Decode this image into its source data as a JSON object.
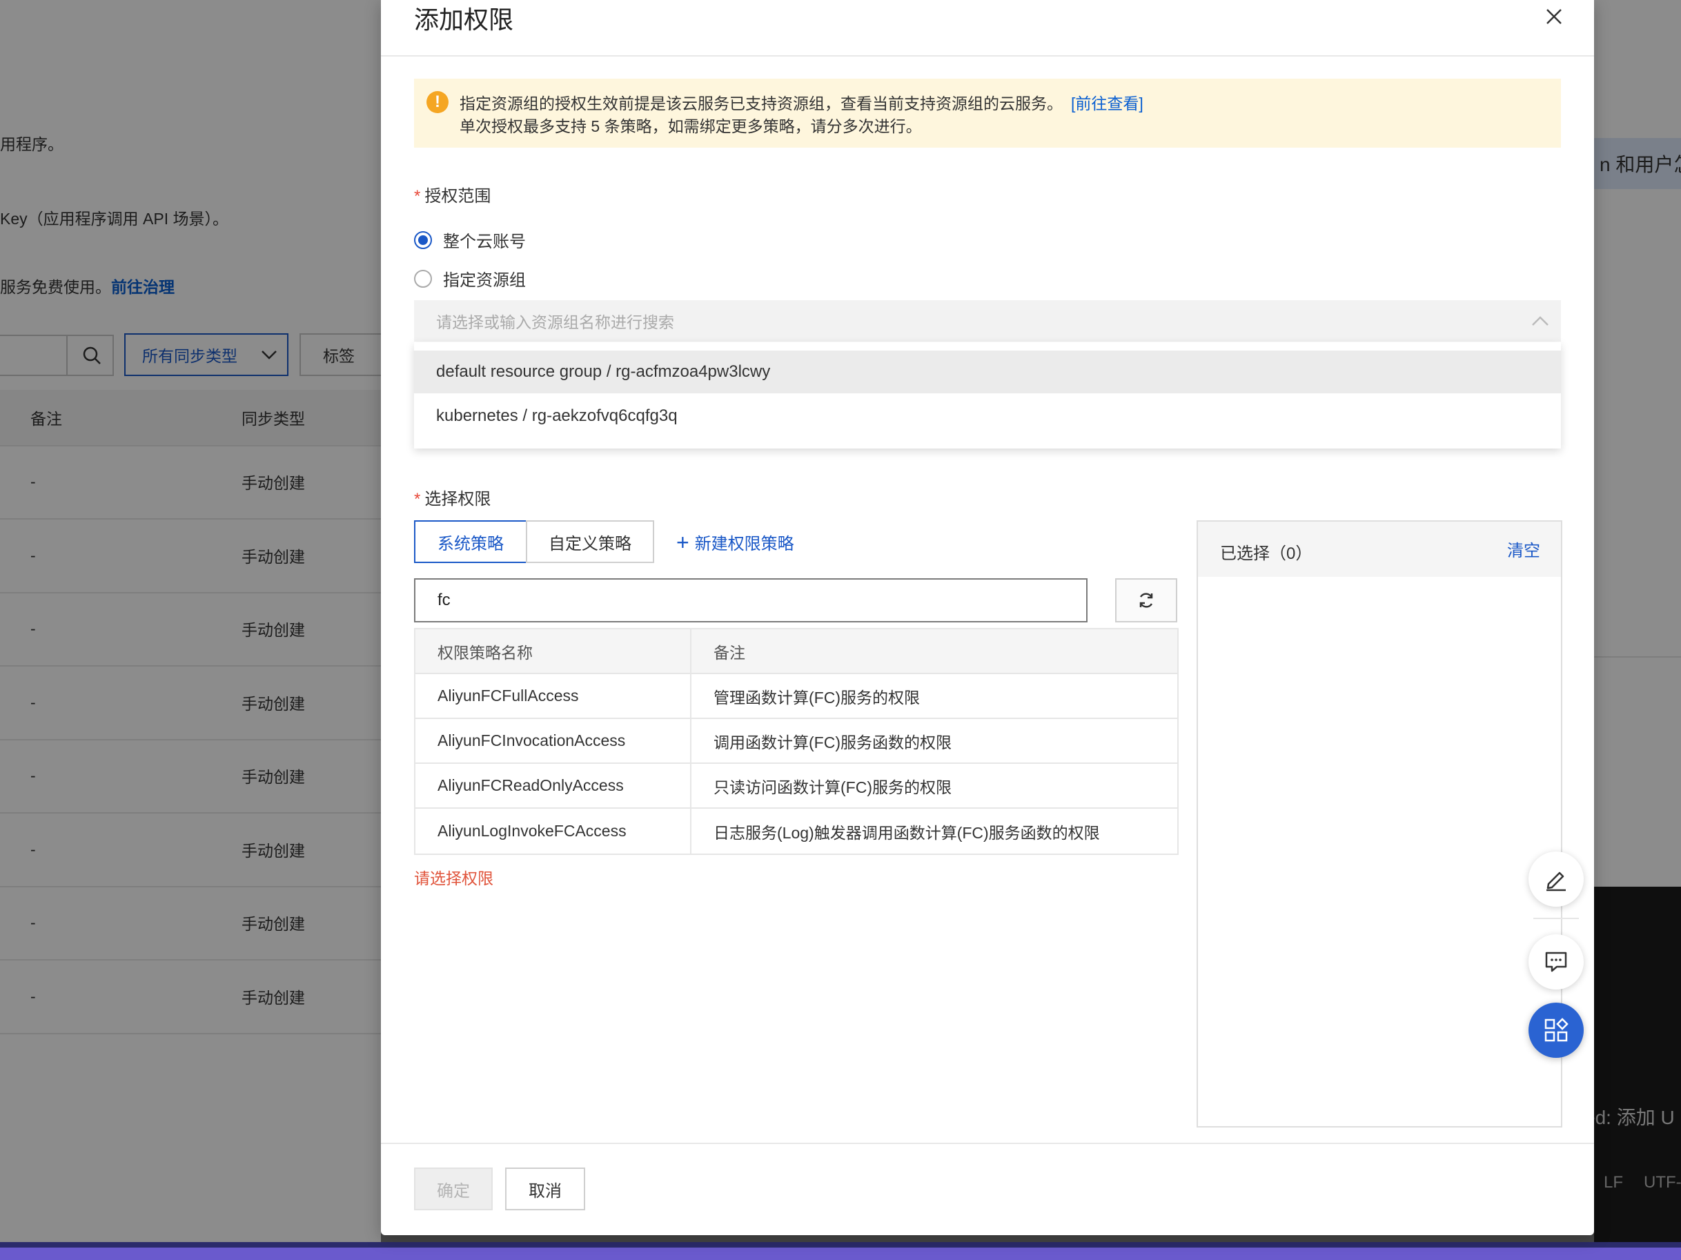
{
  "background": {
    "hint_line1": "用程序。",
    "hint_line2": "Key（应用程序调用 API 场景）。",
    "hint_line3_text": "服务免费使用。",
    "hint_line3_link": "前往治理",
    "sync_type_select": "所有同步类型",
    "tag_button": "标签",
    "columns": [
      "备注",
      "同步类型"
    ],
    "rows": [
      {
        "note": "-",
        "sync_type": "手动创建"
      },
      {
        "note": "-",
        "sync_type": "手动创建"
      },
      {
        "note": "-",
        "sync_type": "手动创建"
      },
      {
        "note": "-",
        "sync_type": "手动创建"
      },
      {
        "note": "-",
        "sync_type": "手动创建"
      },
      {
        "note": "-",
        "sync_type": "手动创建"
      },
      {
        "note": "-",
        "sync_type": "手动创建"
      },
      {
        "note": "-",
        "sync_type": "手动创建"
      }
    ],
    "right_badge": "n 和用户怎",
    "terminal_text": "ed: 添加 U",
    "status_lf": "LF",
    "status_encoding": "UTF-"
  },
  "modal": {
    "title": "添加权限",
    "notice": {
      "line1": "指定资源组的授权生效前提是该云服务已支持资源组，查看当前支持资源组的云服务。",
      "link": "[前往查看]",
      "line2": "单次授权最多支持 5 条策略，如需绑定更多策略，请分多次进行。"
    },
    "scope": {
      "label": "授权范围",
      "options": [
        {
          "label": "整个云账号",
          "checked": true
        },
        {
          "label": "指定资源组",
          "checked": false
        }
      ],
      "resource_group_placeholder": "请选择或输入资源组名称进行搜索",
      "resource_group_options": [
        "default resource group / rg-acfmzoa4pw3lcwy",
        "kubernetes / rg-aekzofvq6cqfg3q"
      ]
    },
    "permissions": {
      "label": "选择权限",
      "tabs": [
        {
          "label": "系统策略",
          "active": true
        },
        {
          "label": "自定义策略",
          "active": false
        }
      ],
      "new_policy_link": "新建权限策略",
      "search_value": "fc",
      "columns": [
        "权限策略名称",
        "备注"
      ],
      "rows": [
        {
          "name": "AliyunFCFullAccess",
          "note": "管理函数计算(FC)服务的权限"
        },
        {
          "name": "AliyunFCInvocationAccess",
          "note": "调用函数计算(FC)服务函数的权限"
        },
        {
          "name": "AliyunFCReadOnlyAccess",
          "note": "只读访问函数计算(FC)服务的权限"
        },
        {
          "name": "AliyunLogInvokeFCAccess",
          "note": "日志服务(Log)触发器调用函数计算(FC)服务函数的权限"
        }
      ],
      "error": "请选择权限",
      "selected_title": "已选择（0）",
      "clear_label": "清空"
    },
    "footer": {
      "ok_label": "确定",
      "cancel_label": "取消"
    }
  },
  "icons": [
    "close-icon",
    "warning-icon",
    "chevron-up-icon",
    "plus-icon",
    "refresh-icon",
    "search-icon",
    "chevron-down-icon",
    "edit-icon",
    "feedback-icon",
    "apps-icon"
  ],
  "colors": {
    "primary": "#1a58c7",
    "notice_bg": "#fef6dd",
    "warning": "#f5a623",
    "error": "#e0543b"
  }
}
